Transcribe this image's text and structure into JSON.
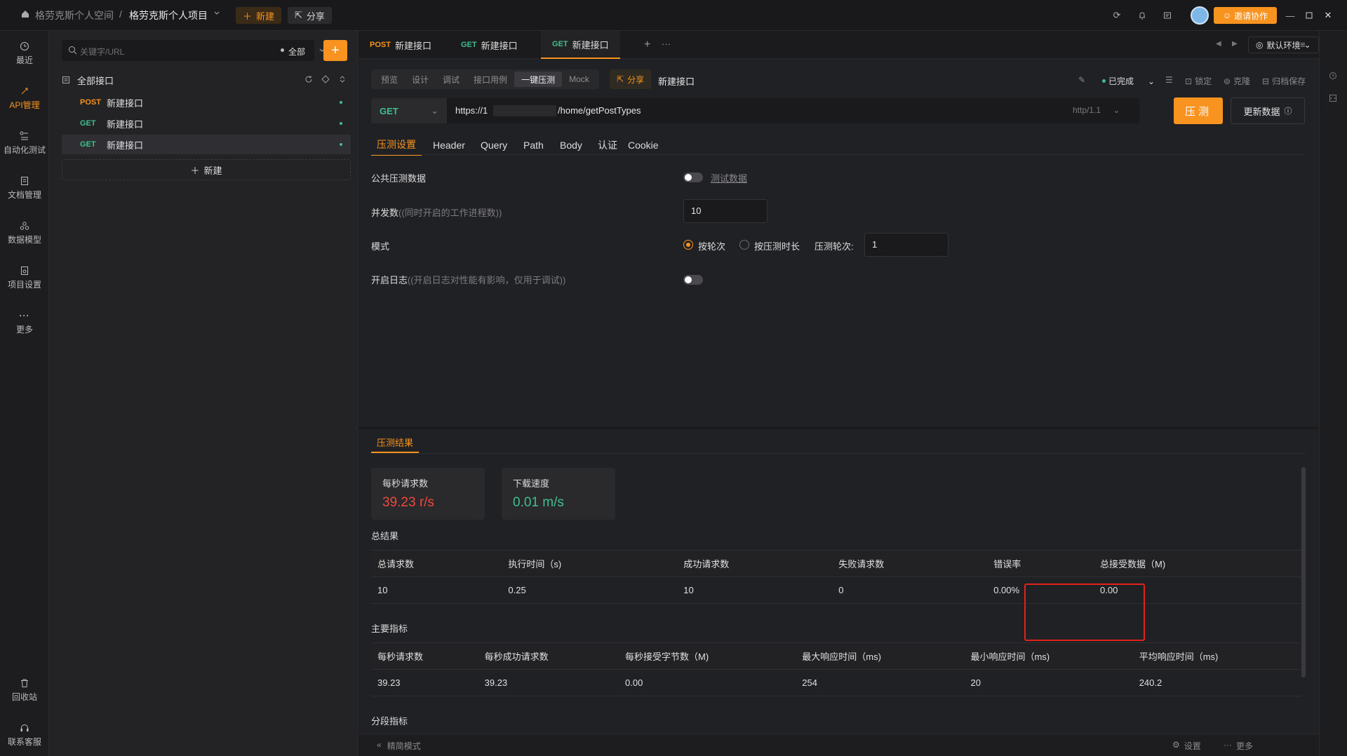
{
  "topbar": {
    "workspace": "格劳克斯个人空间",
    "separator": "/",
    "project": "格劳克斯个人项目",
    "new_label": "新建",
    "share_label": "分享",
    "invite_label": "邀请协作"
  },
  "rail": {
    "items": [
      {
        "label": "最近",
        "icon": "clock-icon"
      },
      {
        "label": "API管理",
        "icon": "api-icon"
      },
      {
        "label": "自动化测试",
        "icon": "flow-icon"
      },
      {
        "label": "文档管理",
        "icon": "doc-icon"
      },
      {
        "label": "数据模型",
        "icon": "model-icon"
      },
      {
        "label": "项目设置",
        "icon": "settings-icon"
      },
      {
        "label": "更多",
        "icon": "more-icon"
      }
    ],
    "bottom": [
      {
        "label": "回收站",
        "icon": "trash-icon"
      },
      {
        "label": "联系客服",
        "icon": "headset-icon"
      }
    ]
  },
  "tree": {
    "search_placeholder": "关键字/URL",
    "filter": "全部",
    "root": "全部接口",
    "items": [
      {
        "method": "POST",
        "name": "新建接口"
      },
      {
        "method": "GET",
        "name": "新建接口"
      },
      {
        "method": "GET",
        "name": "新建接口"
      }
    ],
    "new_label": "新建"
  },
  "tabs": [
    {
      "method": "POST",
      "name": "新建接口"
    },
    {
      "method": "GET",
      "name": "新建接口"
    },
    {
      "method": "GET",
      "name": "新建接口"
    }
  ],
  "env": "默认环境",
  "subtabs": [
    "预览",
    "设计",
    "调试",
    "接口用例",
    "一键压测",
    "Mock"
  ],
  "share_chip": "分享",
  "api_title": "新建接口",
  "status": "已完成",
  "actions": [
    "锁定",
    "克隆",
    "归档保存"
  ],
  "request": {
    "method": "GET",
    "url_prefix": "https://1",
    "url_suffix": "/home/getPostTypes",
    "protocol": "http/1.1",
    "run_label": "压测",
    "update_label": "更新数据"
  },
  "param_tabs": [
    "压测设置",
    "Header",
    "Query",
    "Path",
    "Body",
    "认证",
    "Cookie"
  ],
  "settings": {
    "public_data_label": "公共压测数据",
    "public_data_link": "测试数据",
    "concurrency_label": "并发数",
    "concurrency_hint": "((同时开启的工作进程数))",
    "concurrency_value": "10",
    "mode_label": "模式",
    "mode_by_round": "按轮次",
    "mode_by_duration": "按压测时长",
    "rounds_label": "压测轮次:",
    "rounds_value": "1",
    "log_label": "开启日志",
    "log_hint": "((开启日志对性能有影响，仅用于调试))"
  },
  "results": {
    "tab": "压测结果",
    "cards": [
      {
        "label": "每秒请求数",
        "value": "39.23 r/s",
        "color": "#f0483e"
      },
      {
        "label": "下载速度",
        "value": "0.01 m/s",
        "color": "#3fbf8f"
      }
    ],
    "summary_title": "总结果",
    "summary_headers": [
      "总请求数",
      "执行时间（s)",
      "成功请求数",
      "失败请求数",
      "错误率",
      "总接受数据（M)"
    ],
    "summary_values": [
      "10",
      "0.25",
      "10",
      "0",
      "0.00%",
      "0.00"
    ],
    "main_title": "主要指标",
    "main_headers": [
      "每秒请求数",
      "每秒成功请求数",
      "每秒接受字节数（M)",
      "最大响应时间（ms)",
      "最小响应时间（ms)",
      "平均响应时间（ms)"
    ],
    "main_values": [
      "39.23",
      "39.23",
      "0.00",
      "254",
      "20",
      "240.2"
    ],
    "segment_title": "分段指标"
  },
  "footer": {
    "mode": "精简模式",
    "settings": "设置",
    "more": "更多"
  },
  "colors": {
    "accent": "#f7931e",
    "get": "#3fbf8f",
    "highlight": "#e2231a"
  }
}
